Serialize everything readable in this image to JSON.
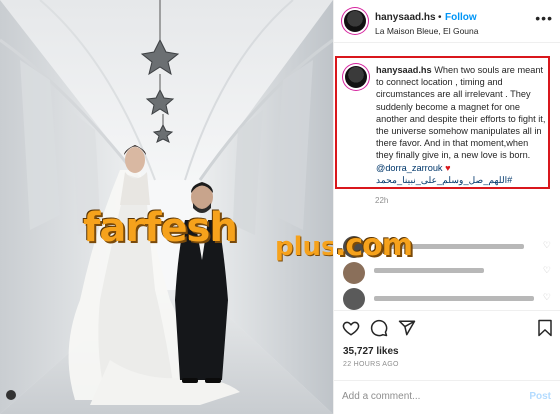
{
  "post": {
    "username": "hanysaad.hs",
    "follow_separator": "•",
    "follow_label": "Follow",
    "location": "La Maison Bleue, El Gouna",
    "more_glyph": "•••"
  },
  "caption": {
    "username": "hanysaad.hs",
    "text": "When two souls are meant to connect location , timing and circumstances are all irrelevant . They suddenly become a magnet for one another and despite their efforts to fight it, the universe somehow manipulates all in there favor. And in that moment,when they finally give in, a new love is born.",
    "mention": "@dorra_zarrouk",
    "heart": "♥",
    "hashtag": "#اللهم_صل_وسلم_على_نبينا_محمد"
  },
  "caption_time": "22h",
  "likes": "35,727 likes",
  "posted_time": "22 HOURS AGO",
  "comment": {
    "placeholder": "Add a comment...",
    "post_label": "Post"
  },
  "watermark": {
    "name": "farfesh",
    "plus": "plus",
    "domain": ".com"
  },
  "photo_credit": "",
  "colors": {
    "accent": "#0095f6",
    "highlight_border": "#d9171c",
    "watermark": "#f6a21c"
  }
}
